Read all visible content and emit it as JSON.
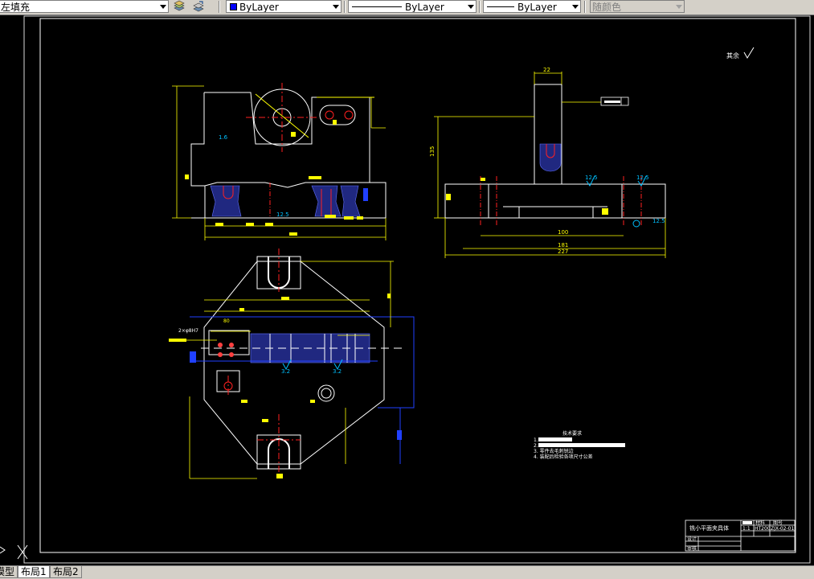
{
  "toolbar": {
    "hatch_combo": "左填充",
    "color_combo": "ByLayer",
    "linetype_combo": "ByLayer",
    "lineweight_combo": "ByLayer",
    "plotstyle_combo": "随颜色"
  },
  "drawing": {
    "roughness_note": "其余",
    "top_dim_width": "22",
    "tol_frame": "⊥ 0.02 A",
    "right_dim_height": "135",
    "dim_100": "100",
    "dim_181": "181",
    "dim_227": "227",
    "rough_12_5": "12.5",
    "rough_3_2": "3.2",
    "rough_1_6": "1.6",
    "slot_callout": "2×φ8H7",
    "dim_80": "80",
    "tech_req_title": "技术要求",
    "tech_req_1": "1.",
    "tech_req_2": "2.",
    "tech_req_3": "3. 零件去毛刺锐边",
    "tech_req_4": "4. 装配后检验各项尺寸公差",
    "title_name": "铣小平面夹具体",
    "title_material": "HT200",
    "title_scale": "1:1",
    "title_drawing_no": "ZJX-02-01",
    "title_hdr_material": "材料",
    "title_hdr_drawing_no": "图号",
    "title_design": "设计",
    "title_review": "审核"
  },
  "tabs": [
    "模型",
    "布局1",
    "布局2"
  ]
}
